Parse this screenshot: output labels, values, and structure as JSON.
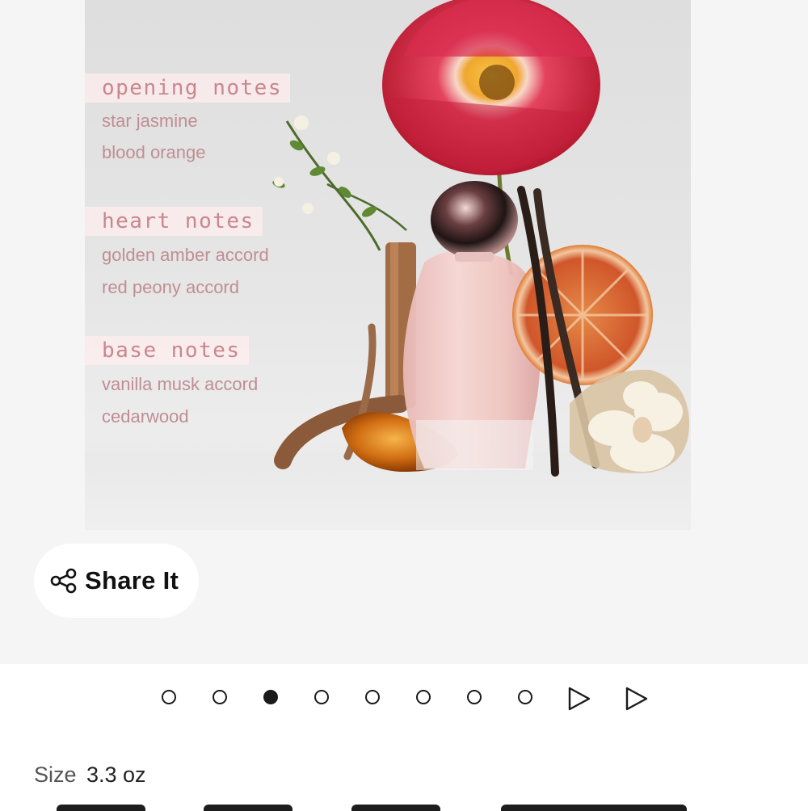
{
  "product_image": {
    "notes": [
      {
        "heading": "opening notes",
        "items": [
          "star jasmine",
          "blood orange"
        ]
      },
      {
        "heading": "heart notes",
        "items": [
          "golden amber accord",
          "red peony accord"
        ]
      },
      {
        "heading": "base notes",
        "items": [
          "vanilla musk accord",
          "cedarwood"
        ]
      }
    ]
  },
  "share": {
    "label": "Share It",
    "icon": "share-icon"
  },
  "pager": {
    "dot_count": 8,
    "active_index": 2,
    "arrow_icon": "play-arrow-icon"
  },
  "size": {
    "label": "Size",
    "value": "3.3 oz"
  }
}
